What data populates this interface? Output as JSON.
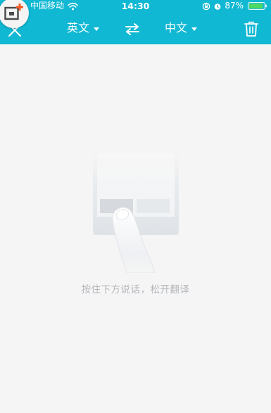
{
  "status_bar": {
    "carrier": "中国移动",
    "time": "14:30",
    "battery": "87%"
  },
  "toolbar": {
    "source_language": "英文",
    "target_language": "中文"
  },
  "empty_state": {
    "hint": "按住下方说话，松开翻译"
  },
  "colors": {
    "header": "#11b8d3",
    "background": "#f5f5f5",
    "hint_text": "#b3b6bb",
    "battery": "#4cd964"
  },
  "icons": {
    "close": "close-icon",
    "swap": "swap-arrows-icon",
    "trash": "trash-icon",
    "wifi": "wifi-icon",
    "lock_rotation": "orientation-lock-icon",
    "alarm": "alarm-icon",
    "battery": "battery-icon",
    "floating_badge": "floating-window-icon"
  }
}
